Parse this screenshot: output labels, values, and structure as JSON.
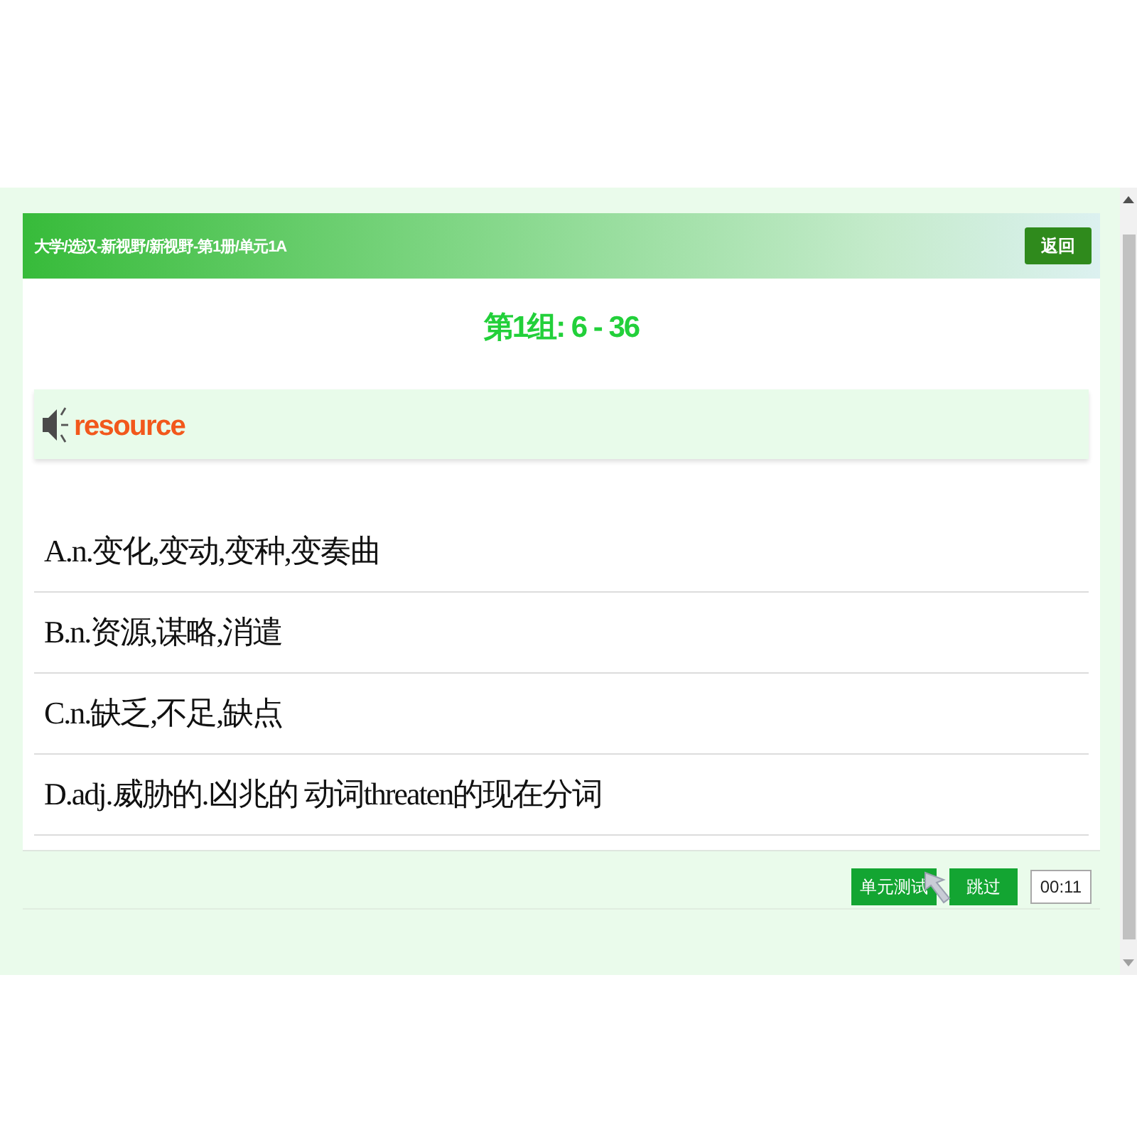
{
  "header": {
    "breadcrumb": "大学/选汉-新视野/新视野-第1册/单元1A",
    "back_button": "返回"
  },
  "group_title": "第1组: 6 - 36",
  "word": {
    "text": "resource"
  },
  "options": [
    {
      "label": "A.n.变化,变动,变种,变奏曲",
      "selected": false
    },
    {
      "label": "B.n.资源,谋略,消遣",
      "selected": false
    },
    {
      "label": "C.n.缺乏,不足,缺点",
      "selected": false
    },
    {
      "label": "D.adj.威胁的.凶兆的 动词threaten的现在分词",
      "selected": false
    }
  ],
  "footer": {
    "buttons": [
      "单元测试",
      "跳过"
    ],
    "timer": "00:11"
  }
}
